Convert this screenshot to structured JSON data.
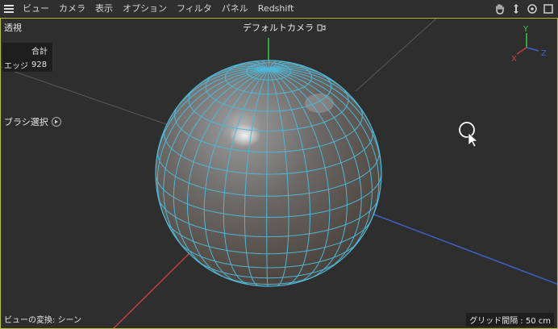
{
  "menu": {
    "items": [
      "ビュー",
      "カメラ",
      "表示",
      "オプション",
      "フィルタ",
      "パネル",
      "Redshift"
    ]
  },
  "viewport": {
    "projection_label": "透視",
    "camera_label": "デフォルトカメラ",
    "info": {
      "header": "合計",
      "row_label": "エッジ",
      "row_value": "928"
    },
    "brush_label": "ブラシ選択",
    "transform_label": "ビューの変換: シーン",
    "grid_label": "グリッド間隔 : 50 cm",
    "axis_labels": {
      "x": "X",
      "y": "Y",
      "z": "Z"
    }
  },
  "colors": {
    "sphere_wire": "#4fb6d6",
    "axis_x": "#c24040",
    "axis_y": "#3ccd4c",
    "axis_z": "#3e63c8",
    "frame": "#b5c23a"
  }
}
